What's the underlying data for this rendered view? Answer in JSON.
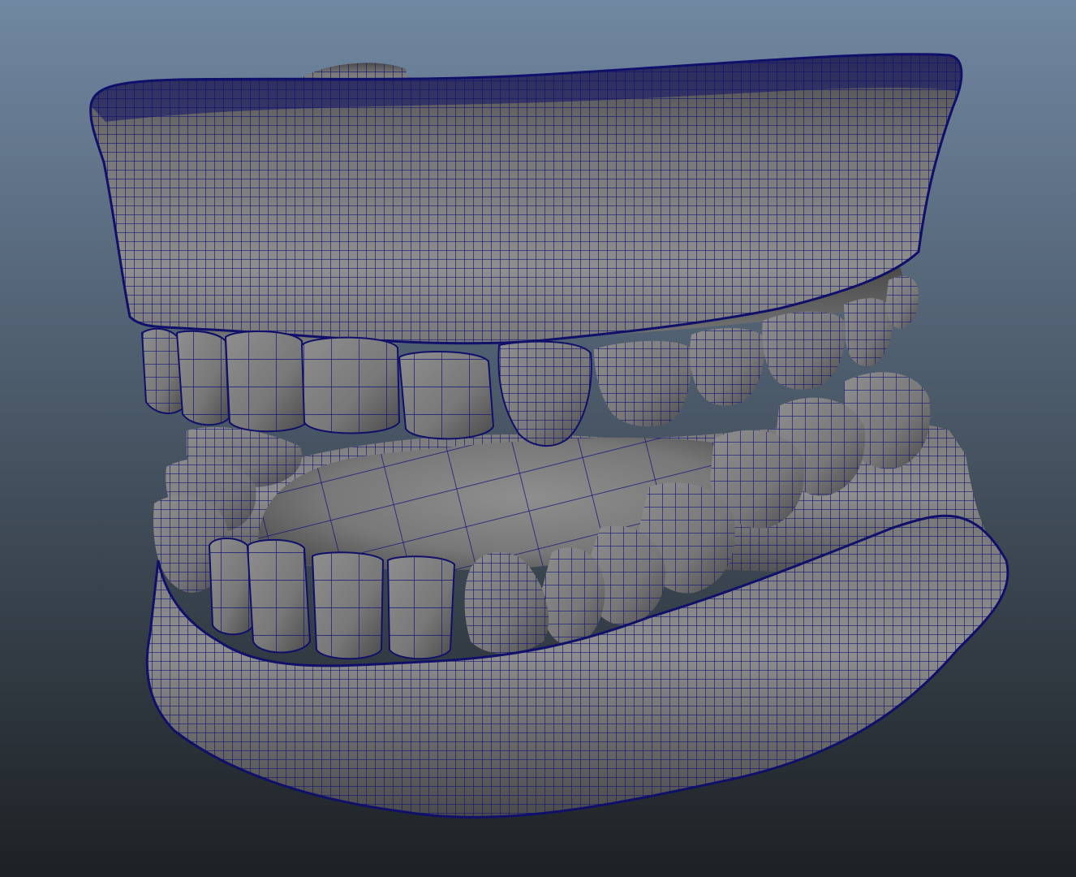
{
  "viewport": {
    "background_top": "#7188a2",
    "background_bottom": "#1d2124"
  },
  "model": {
    "surface_color": "#787878",
    "surface_light": "#8e8e8e",
    "surface_dark": "#4a4a4a",
    "wire_color": "#15157a",
    "rim_color": "#10106a"
  },
  "icons": {
    "mesh": "wireframe-dentures"
  }
}
